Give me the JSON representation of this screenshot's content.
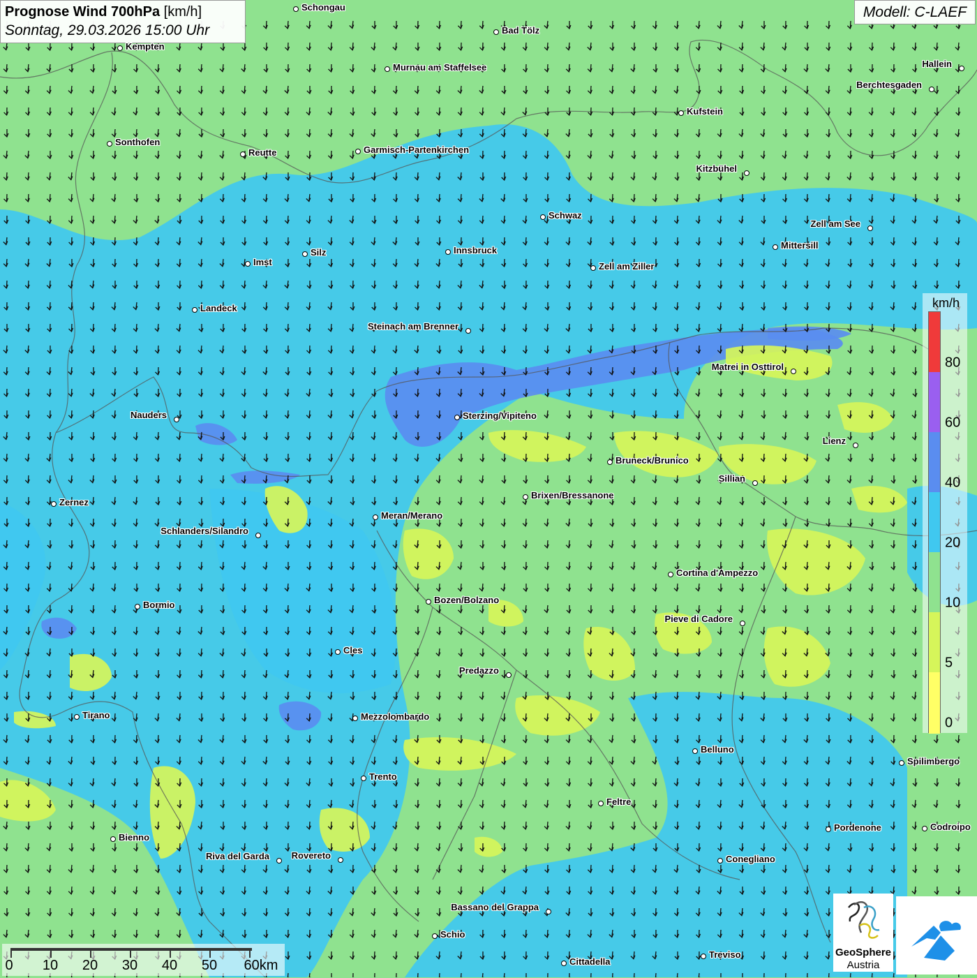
{
  "title": {
    "main": "Prognose Wind 700hPa",
    "unit": "[km/h]",
    "datetime": "Sonntag, 29.03.2026 15:00 Uhr"
  },
  "model": "Modell: C-LAEF",
  "legend": {
    "unit": "km/h",
    "labels": [
      "80",
      "60",
      "40",
      "20",
      "10",
      "5",
      "0"
    ],
    "colors": {
      "c0_5": "#ffff66",
      "c5_10": "#d6f55a",
      "c10_20": "#8fe28f",
      "c20_40": "#40c8f0",
      "c40_60": "#5a8df0",
      "c60_80": "#9a5ff0",
      "c80_plus": "#f03a3a"
    }
  },
  "scalebar": {
    "labels": [
      "0",
      "10",
      "20",
      "30",
      "40",
      "50",
      "60km"
    ]
  },
  "logos": {
    "geosphere_line1": "GeoSphere",
    "geosphere_line2": "Austria",
    "geosphere_icon": "geosphere-logo-icon",
    "app_icon": "mountain-cloud-app-icon"
  },
  "cities": [
    {
      "name": "Schongau",
      "label_side": "right"
    },
    {
      "name": "Bad Tölz",
      "label_side": "right"
    },
    {
      "name": "Kempten",
      "label_side": "right"
    },
    {
      "name": "Murnau am Staffelsee",
      "label_side": "right"
    },
    {
      "name": "Hallein",
      "label_side": "left"
    },
    {
      "name": "Berchtesgaden",
      "label_side": "left"
    },
    {
      "name": "Kufstein",
      "label_side": "right"
    },
    {
      "name": "Sonthofen",
      "label_side": "right"
    },
    {
      "name": "Reutte",
      "label_side": "right"
    },
    {
      "name": "Garmisch-Partenkirchen",
      "label_side": "right"
    },
    {
      "name": "Kitzbühel",
      "label_side": "left"
    },
    {
      "name": "Schwaz",
      "label_side": "right"
    },
    {
      "name": "Zell am See",
      "label_side": "left"
    },
    {
      "name": "Mittersill",
      "label_side": "right"
    },
    {
      "name": "Innsbruck",
      "label_side": "right"
    },
    {
      "name": "Imst",
      "label_side": "right"
    },
    {
      "name": "Silz",
      "label_side": "right"
    },
    {
      "name": "Zell am Ziller",
      "label_side": "right"
    },
    {
      "name": "Landeck",
      "label_side": "right"
    },
    {
      "name": "Steinach am Brenner",
      "label_side": "left"
    },
    {
      "name": "Matrei in Osttirol",
      "label_side": "left"
    },
    {
      "name": "Nauders",
      "label_side": "left"
    },
    {
      "name": "Sterzing/Vipiteno",
      "label_side": "right"
    },
    {
      "name": "Lienz",
      "label_side": "left"
    },
    {
      "name": "Bruneck/Brunico",
      "label_side": "right"
    },
    {
      "name": "Sillian",
      "label_side": "left"
    },
    {
      "name": "Zernez",
      "label_side": "right"
    },
    {
      "name": "Brixen/Bressanone",
      "label_side": "right"
    },
    {
      "name": "Meran/Merano",
      "label_side": "right"
    },
    {
      "name": "Schlanders/Silandro",
      "label_side": "left"
    },
    {
      "name": "Cortina d'Ampezzo",
      "label_side": "right"
    },
    {
      "name": "Bozen/Bolzano",
      "label_side": "right"
    },
    {
      "name": "Bormio",
      "label_side": "right"
    },
    {
      "name": "Pieve di Cadore",
      "label_side": "left"
    },
    {
      "name": "Cles",
      "label_side": "right"
    },
    {
      "name": "Predazzo",
      "label_side": "left"
    },
    {
      "name": "Tirano",
      "label_side": "right"
    },
    {
      "name": "Mezzolombardo",
      "label_side": "right"
    },
    {
      "name": "Belluno",
      "label_side": "right"
    },
    {
      "name": "Spilimbergo",
      "label_side": "right"
    },
    {
      "name": "Trento",
      "label_side": "right"
    },
    {
      "name": "Feltre",
      "label_side": "right"
    },
    {
      "name": "Pordenone",
      "label_side": "right"
    },
    {
      "name": "Codroipo",
      "label_side": "right"
    },
    {
      "name": "Bienno",
      "label_side": "right"
    },
    {
      "name": "Riva del Garda",
      "label_side": "left"
    },
    {
      "name": "Rovereto",
      "label_side": "left"
    },
    {
      "name": "Conegliano",
      "label_side": "right"
    },
    {
      "name": "Bassano del Grappa",
      "label_side": "left"
    },
    {
      "name": "Schio",
      "label_side": "right"
    },
    {
      "name": "Treviso",
      "label_side": "right"
    },
    {
      "name": "Cittadella",
      "label_side": "right"
    }
  ]
}
